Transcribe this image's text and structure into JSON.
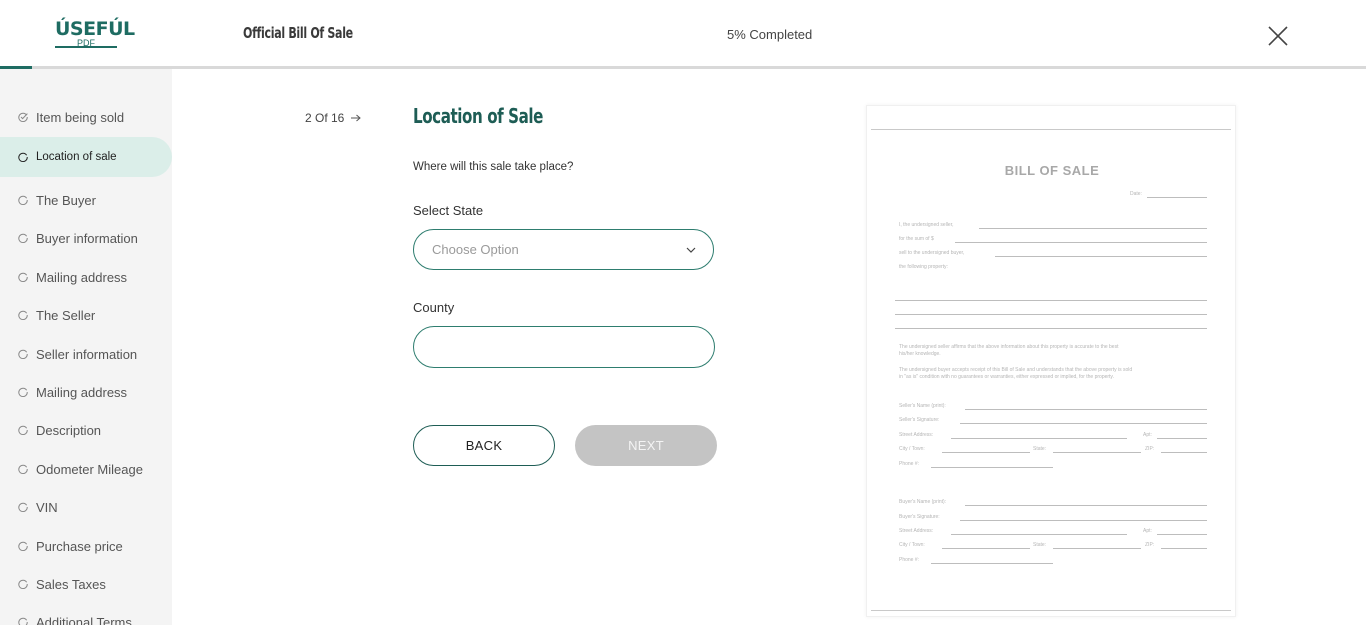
{
  "header": {
    "logo_main": "ÚSEFÚL",
    "logo_sub": "PDF",
    "doc_title": "Official Bill Of Sale",
    "progress_text": "5% Completed",
    "progress_fraction": 0.05
  },
  "sidebar": {
    "items": [
      {
        "label": "Item being sold",
        "state": "done"
      },
      {
        "label": "Location of sale",
        "state": "active"
      },
      {
        "label": "The Buyer",
        "state": "pending"
      },
      {
        "label": "Buyer information",
        "state": "pending"
      },
      {
        "label": "Mailing address",
        "state": "pending"
      },
      {
        "label": "The Seller",
        "state": "pending"
      },
      {
        "label": "Seller information",
        "state": "pending"
      },
      {
        "label": "Mailing address",
        "state": "pending"
      },
      {
        "label": "Description",
        "state": "pending"
      },
      {
        "label": "Odometer Mileage",
        "state": "pending"
      },
      {
        "label": "VIN",
        "state": "pending"
      },
      {
        "label": "Purchase price",
        "state": "pending"
      },
      {
        "label": "Sales Taxes",
        "state": "pending"
      },
      {
        "label": "Additional Terms",
        "state": "pending"
      }
    ]
  },
  "main": {
    "step_count": "2 Of 16",
    "section_title": "Location of Sale",
    "question": "Where will this sale take place?",
    "state_label": "Select State",
    "state_placeholder": "Choose Option",
    "county_label": "County",
    "county_value": "",
    "back_label": "BACK",
    "next_label": "NEXT"
  },
  "preview": {
    "title": "BILL OF SALE",
    "date_label": "Date:",
    "seller_label": "I, the undersigned seller,",
    "sum_label": "for the sum of $",
    "sold_label": "sell to the undersigned buyer,",
    "property_label": "the following property:",
    "affirm_text_1": "The undersigned seller affirms that the above information about this property is accurate to the best",
    "affirm_text_2": "his/her knowledge.",
    "accept_text_1": "The undersigned buyer accepts receipt of this Bill of Sale and understands that the above property is sold",
    "accept_text_2": "in \"as is\" condition with no guarantees or warranties, either expressed or implied, for the property.",
    "seller_name": "Seller's Name (print):",
    "seller_sig": "Seller's Signature:",
    "street": "Street Address:",
    "apt": "Apt:",
    "city": "City / Town:",
    "state": "State:",
    "zip": "ZIP:",
    "phone": "Phone #:",
    "buyer_name": "Buyer's Name (print):",
    "buyer_sig": "Buyer's Signature:"
  },
  "colors": {
    "brand": "#1e6c62",
    "active_bg": "#dbeee9",
    "disabled_btn": "#c4c4c4"
  }
}
